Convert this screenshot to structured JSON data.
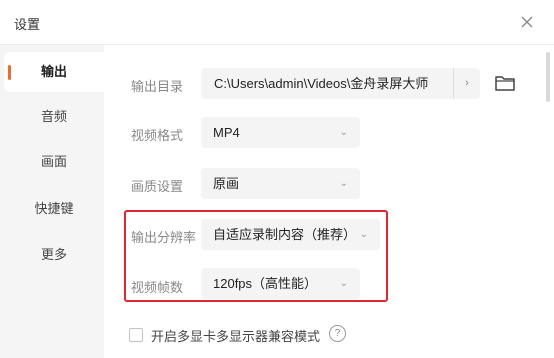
{
  "window": {
    "title": "设置"
  },
  "sidebar": {
    "items": [
      {
        "label": "输出",
        "active": true
      },
      {
        "label": "音频"
      },
      {
        "label": "画面"
      },
      {
        "label": "快捷键"
      },
      {
        "label": "更多"
      }
    ]
  },
  "output": {
    "dir_label": "输出目录",
    "dir_value": "C:\\Users\\admin\\Videos\\金舟录屏大师",
    "dir_arrow": "›",
    "format_label": "视频格式",
    "format_value": "MP4",
    "quality_label": "画质设置",
    "quality_value": "原画",
    "resolution_label": "输出分辨率",
    "resolution_value": "自适应录制内容（推荐）",
    "fps_label": "视频帧数",
    "fps_value": "120fps（高性能）",
    "compat_label": "开启多显卡多显示器兼容模式",
    "help": "?",
    "compat_checked": false
  },
  "colors": {
    "accent": "#f06b2b",
    "highlight": "#e0262e"
  }
}
